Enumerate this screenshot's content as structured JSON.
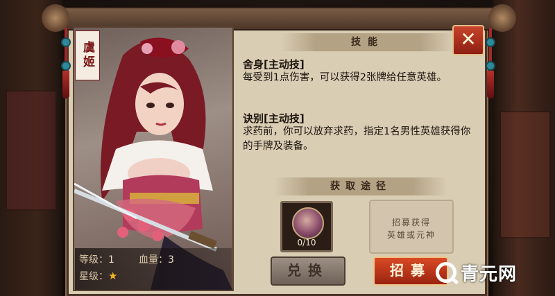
{
  "hero": {
    "name": "虞姬",
    "level_label": "等级：",
    "level_value": "1",
    "hp_label": "血量：",
    "hp_value": "3",
    "star_label": "星级：",
    "stars": 1
  },
  "skills_panel": {
    "title": "技能",
    "close_label": "✕",
    "skills": [
      {
        "name": "舍身[主动技]",
        "desc": "每受到1点伤害，可以获得2张牌给任意英雄。"
      },
      {
        "name": "诀别[主动技]",
        "desc": "求药前，你可以放弃求药，指定1名男性英雄获得你的手牌及装备。"
      }
    ]
  },
  "obtain": {
    "title": "获取途径",
    "shard_progress": "0/10",
    "shard_current": 0,
    "shard_total": 10,
    "recruit_info_line1": "招募获得",
    "recruit_info_line2": "英雄或元神",
    "exchange_button": "兑换",
    "recruit_button": "招募"
  },
  "watermark": {
    "text": "青元网"
  },
  "colors": {
    "accent_red": "#c8432b",
    "parchment": "#d9cdb4",
    "frame_dark": "#4a3428",
    "star_gold": "#f0b825"
  }
}
